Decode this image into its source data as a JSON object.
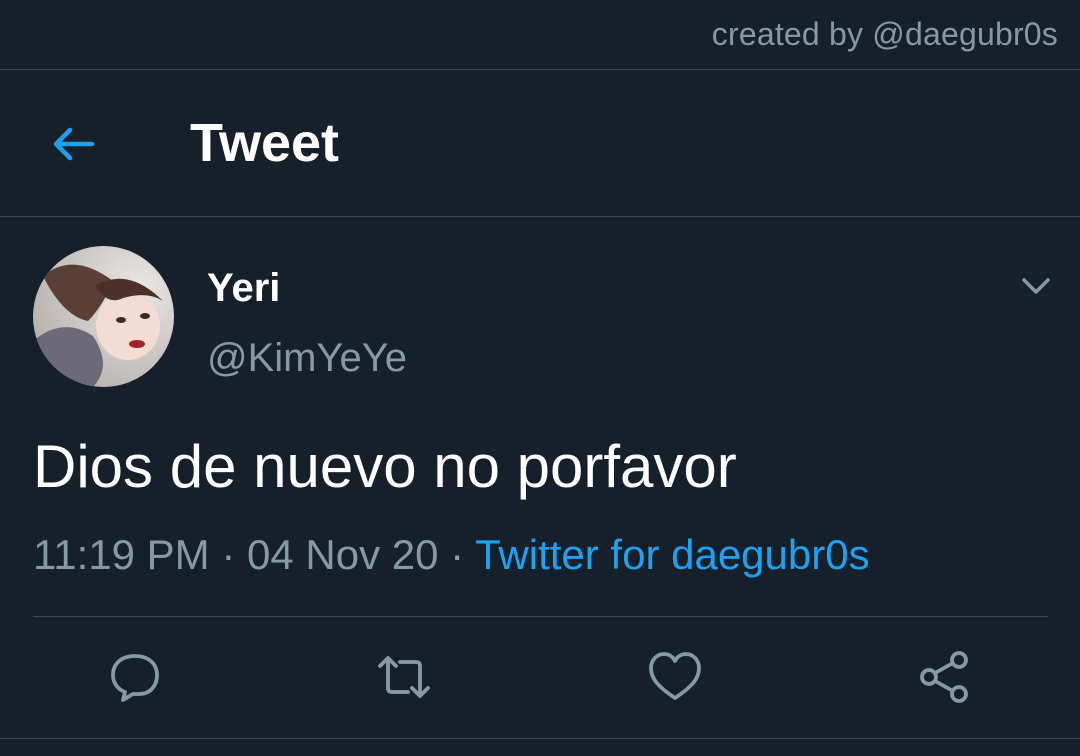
{
  "credit": "created by @daegubr0s",
  "header": {
    "title": "Tweet",
    "back_icon": "arrow-left-icon"
  },
  "tweet": {
    "author": {
      "display_name": "Yeri",
      "handle": "@KimYeYe"
    },
    "text": "Dios de nuevo no porfavor",
    "time": "11:19 PM",
    "separator": "·",
    "date": "04 Nov 20",
    "source": "Twitter for daegubr0s"
  },
  "actions": [
    {
      "name": "reply",
      "icon": "reply-icon"
    },
    {
      "name": "retweet",
      "icon": "retweet-icon"
    },
    {
      "name": "like",
      "icon": "heart-icon"
    },
    {
      "name": "share",
      "icon": "share-icon"
    }
  ],
  "colors": {
    "background": "#15202b",
    "divider": "#38444d",
    "secondary_text": "#8899a6",
    "accent": "#1da1f2",
    "primary_text": "#ffffff"
  }
}
